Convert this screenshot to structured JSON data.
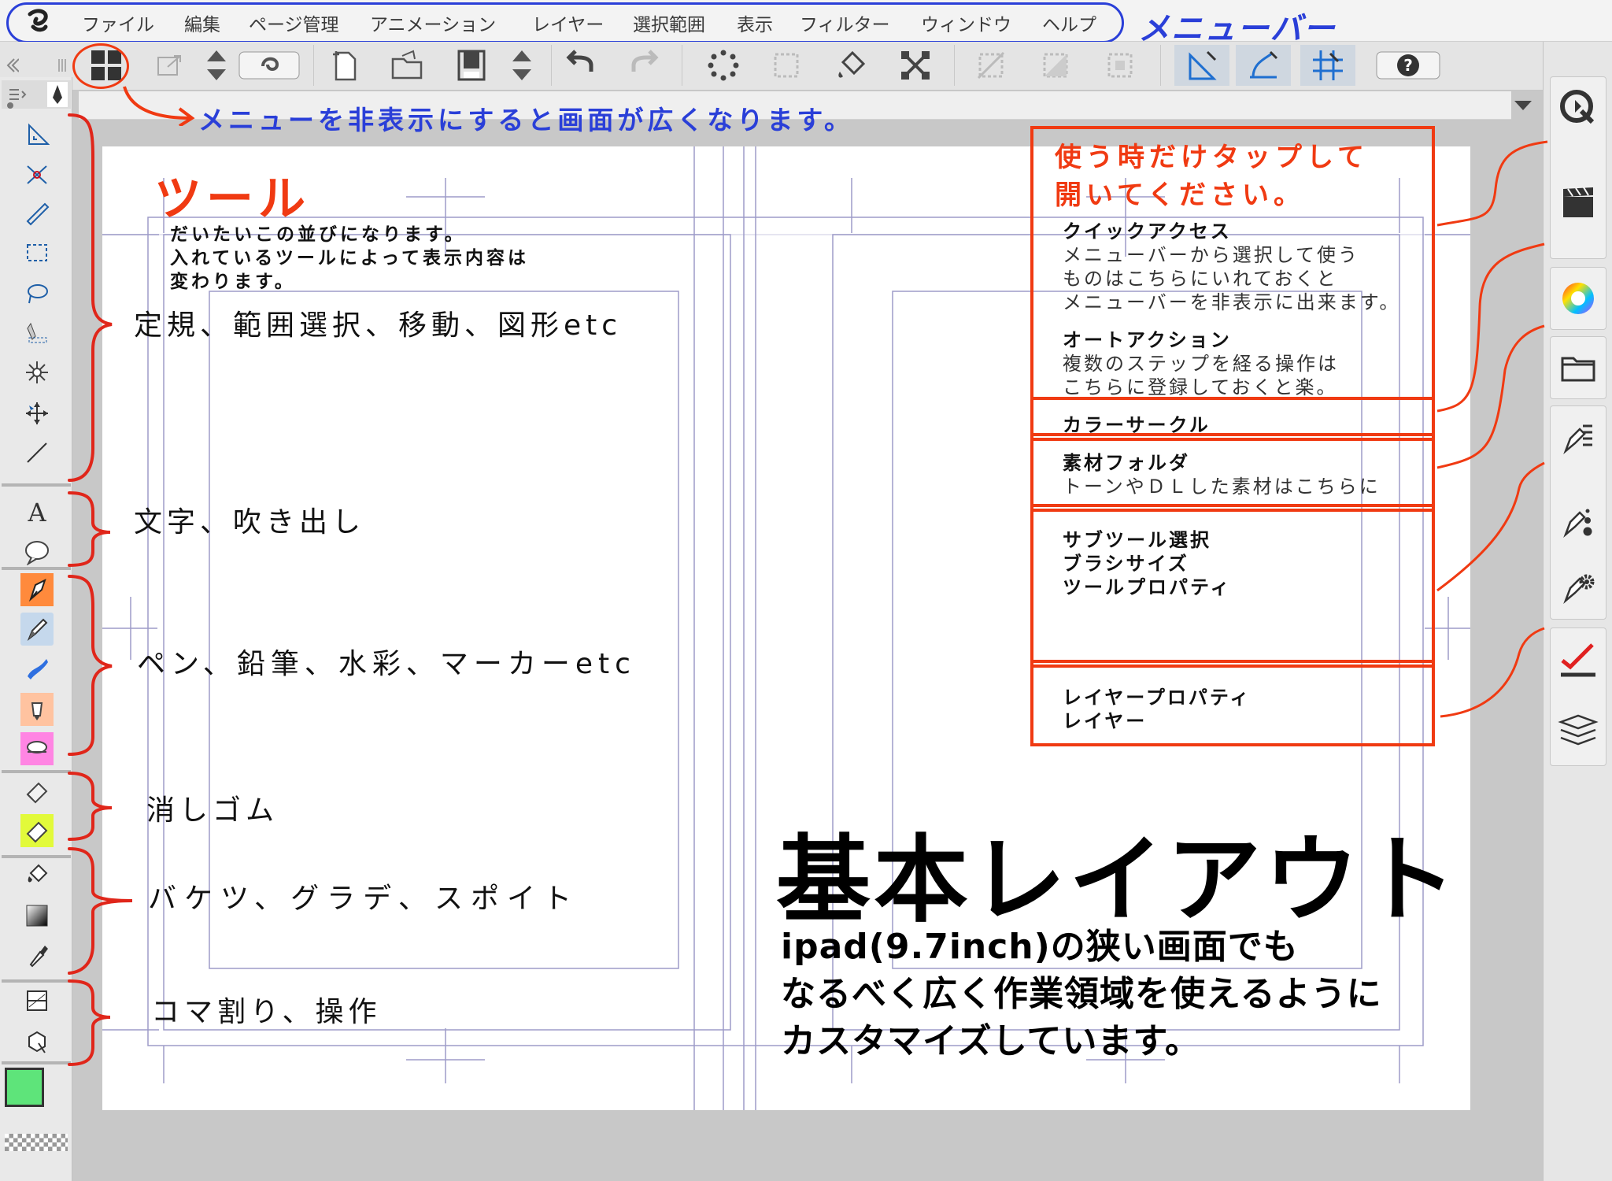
{
  "menubar": {
    "items": [
      "ファイル",
      "編集",
      "ページ管理",
      "アニメーション",
      "レイヤー",
      "選択範囲",
      "表示",
      "フィルター",
      "ウィンドウ",
      "ヘルプ"
    ],
    "annotation": "メニューバー"
  },
  "annotations": {
    "hide_menu": "メニューを非表示にすると画面が広くなります。",
    "tools_title": "ツール",
    "tools_line1": "だいたいこの並びになります。",
    "tools_line2": "入れているツールによって表示内容は",
    "tools_line3": "変わります。",
    "group1": "定規、範囲選択、移動、図形etc",
    "group2": "文字、吹き出し",
    "group3": "ペン、鉛筆、水彩、マーカーetc",
    "group4": "消しゴム",
    "group5": "バケツ、グラデ、スポイト",
    "group6": "コマ割り、操作",
    "tap_line1": "使う時だけタップして",
    "tap_line2": "開いてください。",
    "quick_access_title": "クイックアクセス",
    "quick_access_1": "メニューバーから選択して使う",
    "quick_access_2": "ものはこちらにいれておくと",
    "quick_access_3": "メニューバーを非表示に出来ます。",
    "auto_action_title": "オートアクション",
    "auto_action_1": "複数のステップを経る操作は",
    "auto_action_2": "こちらに登録しておくと楽。",
    "color_circle": "カラーサークル",
    "material_title": "素材フォルダ",
    "material_1": "トーンやＤＬした素材はこちらに",
    "subtool_1": "サブツール選択",
    "subtool_2": "ブラシサイズ",
    "subtool_3": "ツールプロパティ",
    "layer_1": "レイヤープロパティ",
    "layer_2": "レイヤー",
    "big_title": "基本レイアウト",
    "desc_1": "ipad(9.7inch)の狭い画面でも",
    "desc_2": "なるべく広く作業領域を使えるように",
    "desc_3": "カスタマイズしています。"
  },
  "colors": {
    "annotation_red": "#f03a12",
    "annotation_blue": "#2a3fd8",
    "main_color": "#5ee47a"
  }
}
